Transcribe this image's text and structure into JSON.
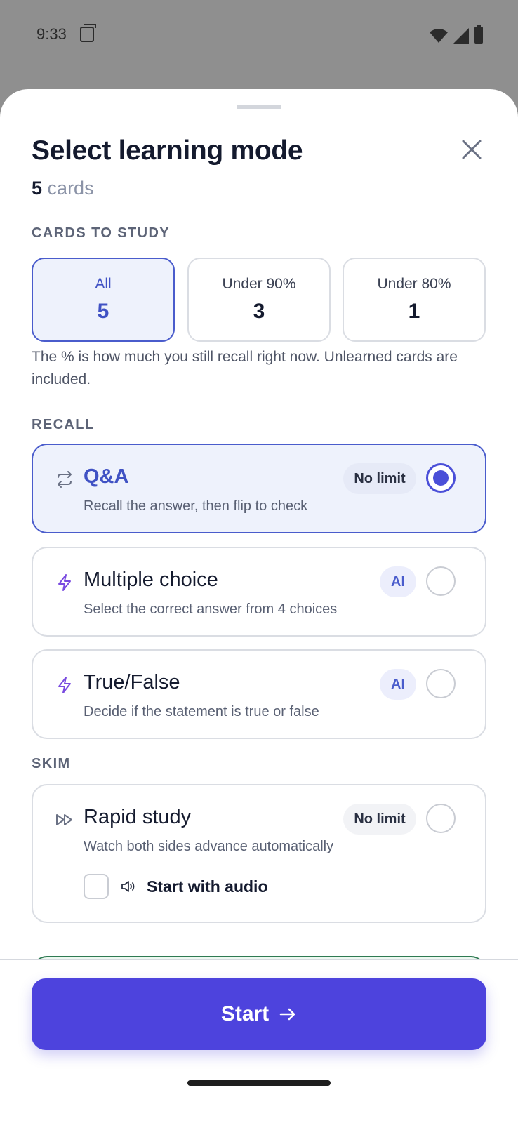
{
  "status": {
    "time": "9:33"
  },
  "header": {
    "title": "Select learning mode",
    "count": "5",
    "count_unit": "cards"
  },
  "cards_to_study": {
    "label": "CARDS TO STUDY",
    "options": [
      {
        "label": "All",
        "value": "5",
        "selected": true
      },
      {
        "label": "Under 90%",
        "value": "3",
        "selected": false
      },
      {
        "label": "Under 80%",
        "value": "1",
        "selected": false
      }
    ],
    "note": "The % is how much you still recall right now. Unlearned cards are included."
  },
  "recall": {
    "label": "RECALL",
    "modes": [
      {
        "title": "Q&A",
        "desc": "Recall the answer, then flip to check",
        "badge": "No limit",
        "icon": "flip-icon",
        "selected": true
      },
      {
        "title": "Multiple choice",
        "desc": "Select the correct answer from 4 choices",
        "badge": "AI",
        "icon": "lightning-icon",
        "selected": false
      },
      {
        "title": "True/False",
        "desc": "Decide if the statement is true or false",
        "badge": "AI",
        "icon": "lightning-icon",
        "selected": false
      }
    ]
  },
  "skim": {
    "label": "SKIM",
    "modes": [
      {
        "title": "Rapid study",
        "desc": "Watch both sides advance automatically",
        "badge": "No limit",
        "icon": "fast-forward-icon",
        "selected": false,
        "option_label": "Start with audio"
      }
    ]
  },
  "footer": {
    "start_label": "Start"
  },
  "colors": {
    "accent": "#4d43dd",
    "selected_border": "#4a5ccc",
    "selected_bg": "#eef2fc",
    "ai_icon": "#7a4be0"
  }
}
